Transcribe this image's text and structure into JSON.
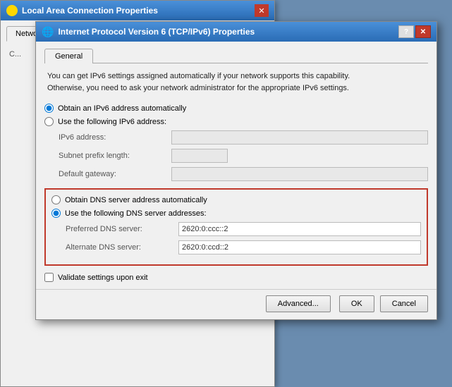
{
  "bgWindow": {
    "title": "Local Area Connection Properties",
    "titleIcon": "network-icon",
    "closeLabel": "✕",
    "tab": "Networking",
    "content": "C..."
  },
  "mainDialog": {
    "title": "Internet Protocol Version 6 (TCP/IPv6) Properties",
    "helpLabel": "?",
    "closeLabel": "✕",
    "tab": "General",
    "description1": "You can get IPv6 settings assigned automatically if your network supports this capability.",
    "description2": "Otherwise, you need to ask your network administrator for the appropriate IPv6 settings.",
    "radio": {
      "autoAddress": "Obtain an IPv6 address automatically",
      "manualAddress": "Use the following IPv6 address:"
    },
    "fields": {
      "ipv6Label": "IPv6 address:",
      "ipv6Value": "",
      "subnetLabel": "Subnet prefix length:",
      "subnetValue": "",
      "gatewayLabel": "Default gateway:",
      "gatewayValue": ""
    },
    "dns": {
      "autoDns": "Obtain DNS server address automatically",
      "manualDns": "Use the following DNS server addresses:",
      "preferredLabel": "Preferred DNS server:",
      "preferredValue": "2620:0:ccc::2",
      "alternateLabel": "Alternate DNS server:",
      "alternateValue": "2620:0:ccd::2"
    },
    "validateLabel": "Validate settings upon exit",
    "advancedLabel": "Advanced...",
    "okLabel": "OK",
    "cancelLabel": "Cancel"
  }
}
